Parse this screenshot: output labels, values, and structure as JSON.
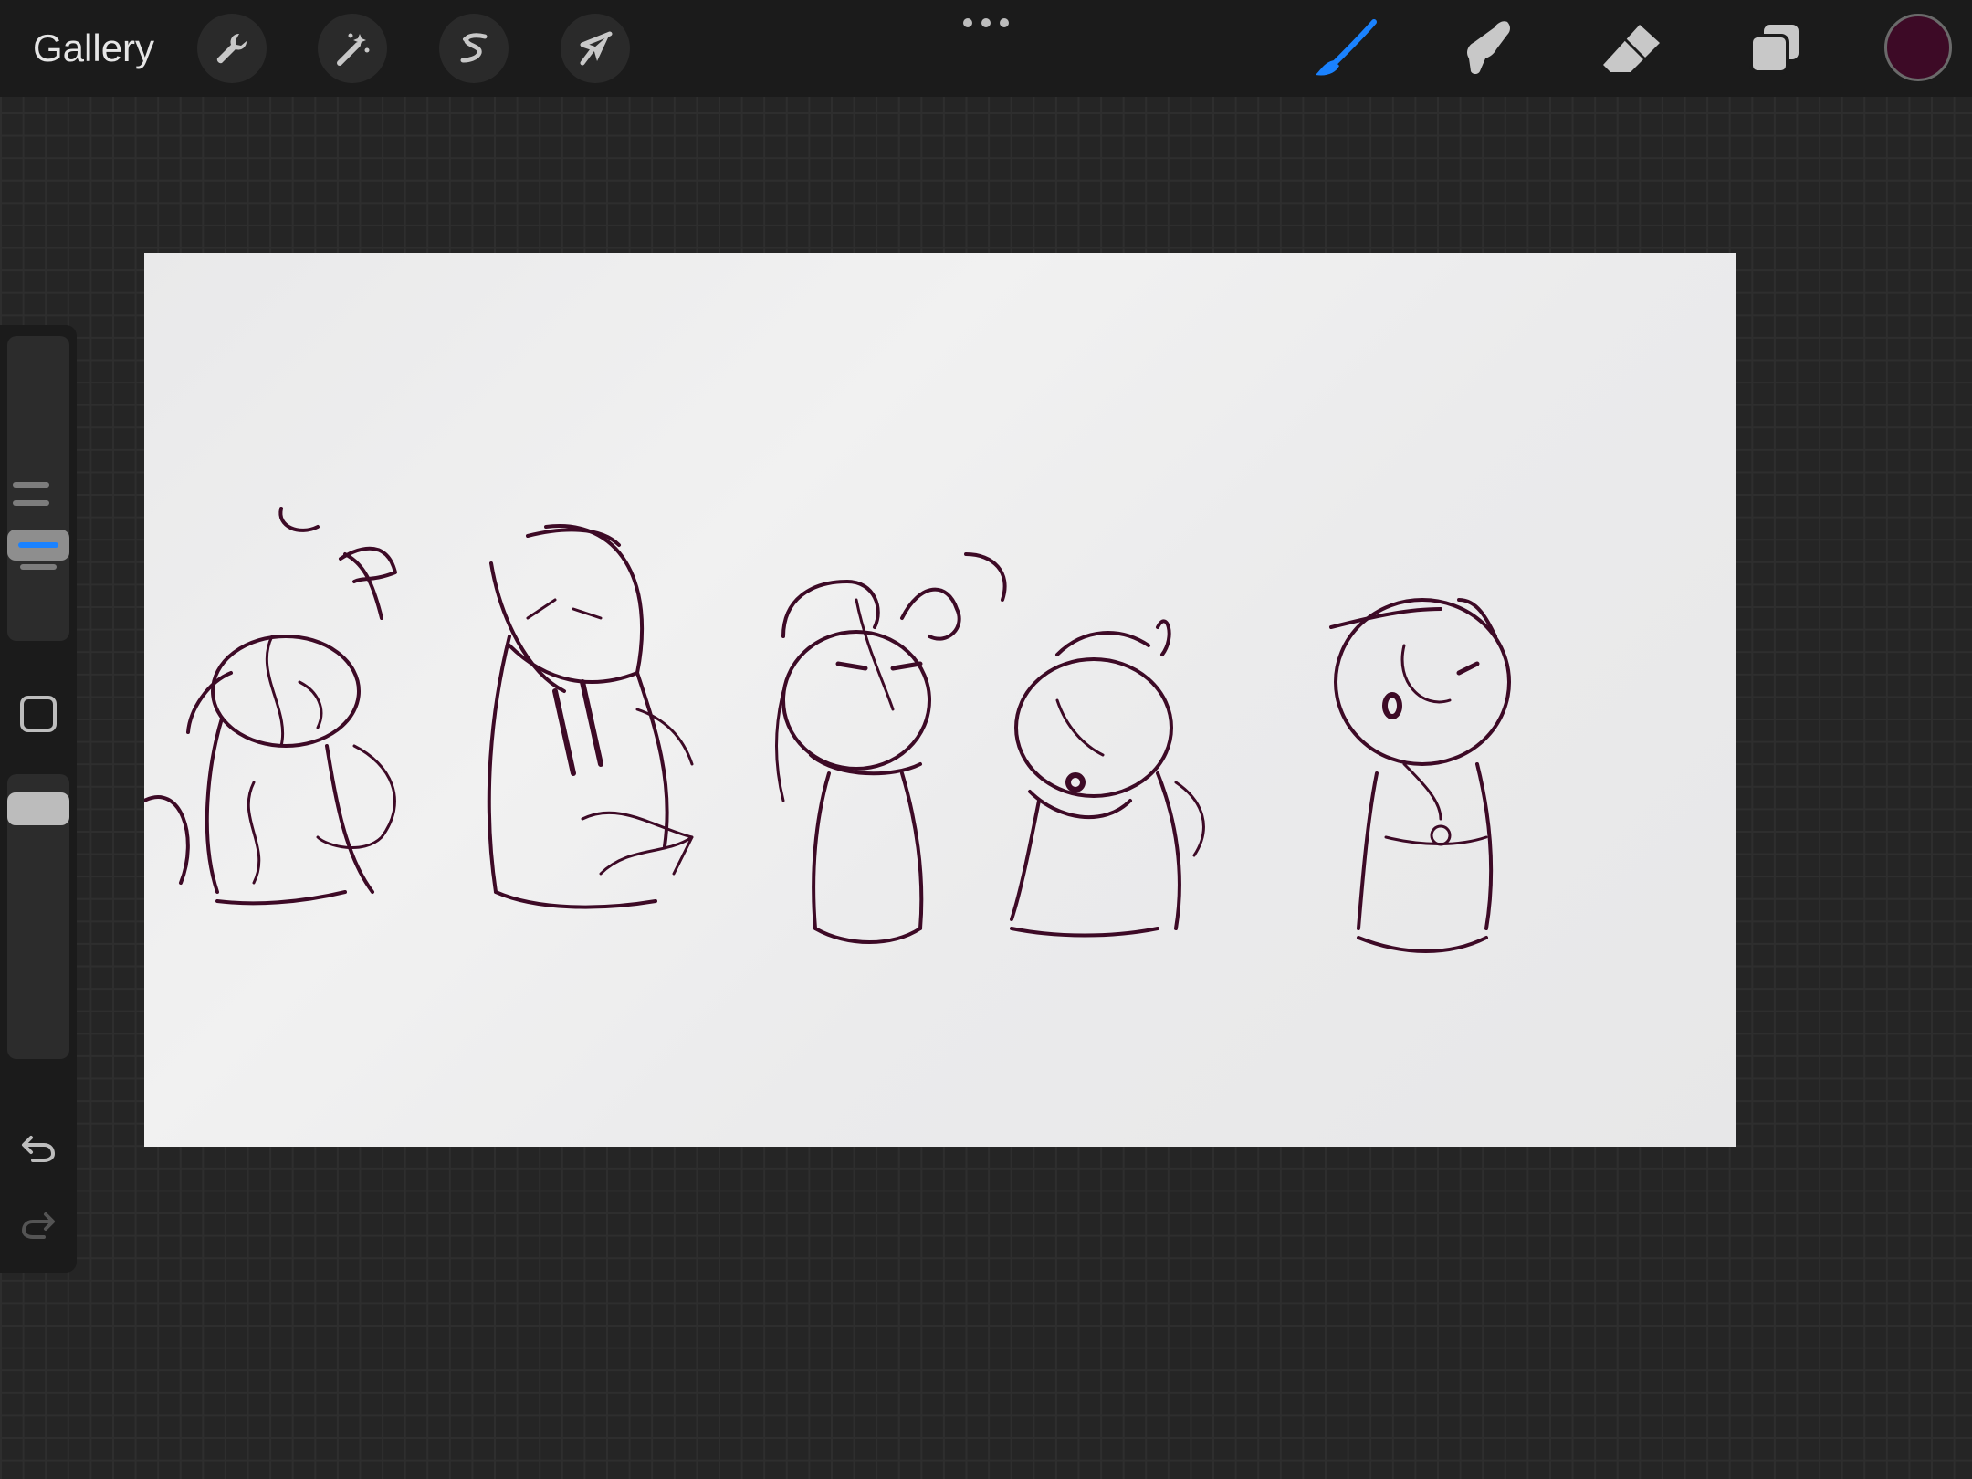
{
  "topbar": {
    "gallery_label": "Gallery",
    "left_tools": [
      {
        "name": "actions",
        "icon": "wrench-icon"
      },
      {
        "name": "adjustments",
        "icon": "magic-wand-icon"
      },
      {
        "name": "selection",
        "icon": "selection-s-icon"
      },
      {
        "name": "transform",
        "icon": "arrow-cursor-icon"
      }
    ],
    "more_icon": "ellipsis-icon",
    "right_tools": [
      {
        "name": "brush",
        "icon": "brush-icon",
        "active": true
      },
      {
        "name": "smudge",
        "icon": "smudge-finger-icon",
        "active": false
      },
      {
        "name": "eraser",
        "icon": "eraser-icon",
        "active": false
      },
      {
        "name": "layers",
        "icon": "layers-icon",
        "active": false
      }
    ],
    "current_color": "#3d0a26"
  },
  "sidebar": {
    "brush_size_icon": "slider-lines-icon",
    "modify_icon": "square-icon",
    "undo_icon": "undo-arrow-icon",
    "redo_icon": "redo-arrow-icon"
  },
  "colors": {
    "accent": "#1a82ff",
    "ink": "#3d0a26",
    "paper": "#ececed"
  }
}
